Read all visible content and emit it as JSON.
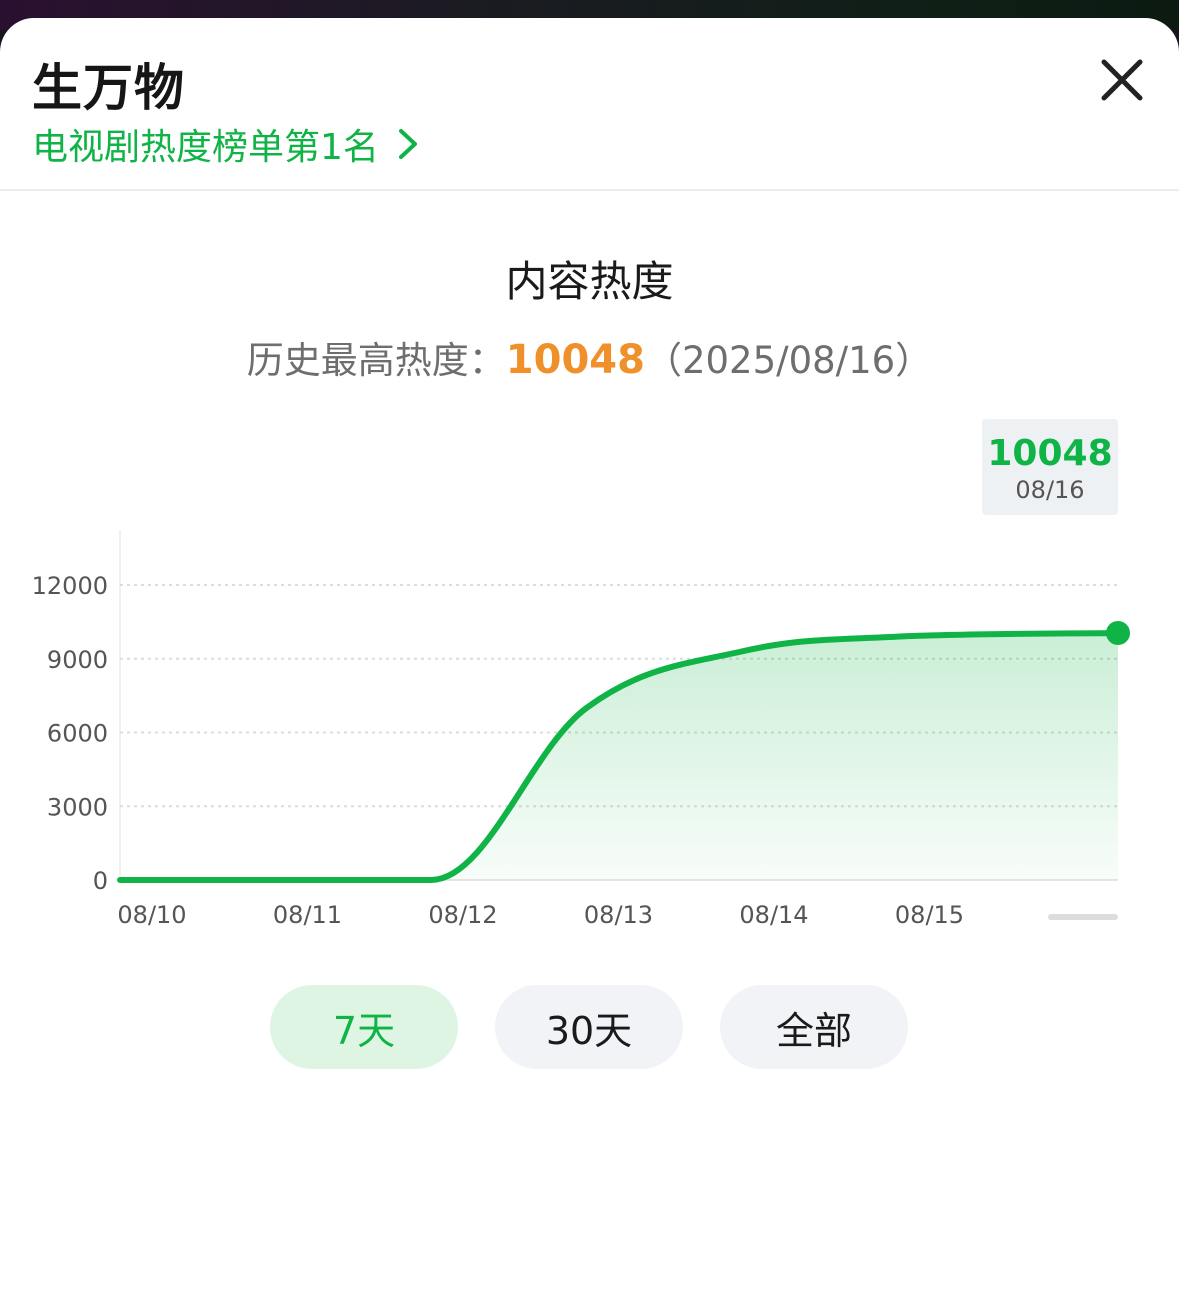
{
  "header": {
    "title": "生万物",
    "rank_link": "电视剧热度榜单第1名"
  },
  "chart_header": {
    "title": "内容热度",
    "peak_label": "历史最高热度：",
    "peak_value": "10048",
    "peak_date": "（2025/08/16）"
  },
  "tooltip": {
    "value": "10048",
    "date": "08/16"
  },
  "range_buttons": [
    {
      "label": "7天",
      "active": true
    },
    {
      "label": "30天",
      "active": false
    },
    {
      "label": "全部",
      "active": false
    }
  ],
  "colors": {
    "accent": "#10b346",
    "peak": "#f0902a"
  },
  "chart_data": {
    "type": "area",
    "title": "内容热度",
    "x": [
      "08/10",
      "08/11",
      "08/12",
      "08/13",
      "08/14",
      "08/15",
      "08/16"
    ],
    "x_tick_labels": [
      "08/10",
      "08/11",
      "08/12",
      "08/13",
      "08/14",
      "08/15"
    ],
    "series": [
      {
        "values": [
          0,
          0,
          0,
          7000,
          9300,
          9900,
          10048
        ]
      }
    ],
    "y_ticks": [
      0,
      3000,
      6000,
      9000,
      12000
    ],
    "ylim": [
      0,
      12000
    ],
    "grid": true,
    "highlight": {
      "x": "08/16",
      "value": 10048
    }
  }
}
